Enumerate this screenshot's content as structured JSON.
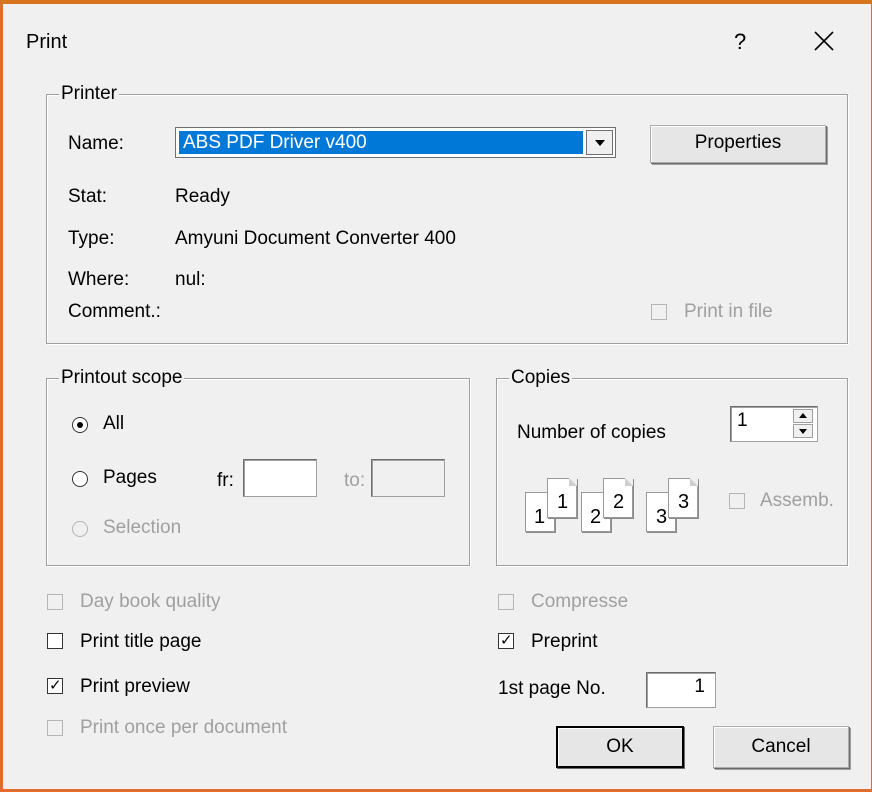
{
  "dialog": {
    "title": "Print",
    "help_label": "?"
  },
  "printer": {
    "legend": "Printer",
    "name_label": "Name:",
    "name_value": "ABS PDF Driver v400",
    "properties_label": "Properties",
    "stat_label": "Stat:",
    "stat_value": "Ready",
    "type_label": "Type:",
    "type_value": "Amyuni Document Converter 400",
    "where_label": "Where:",
    "where_value": "nul:",
    "comment_label": "Comment.:",
    "print_in_file_label": "Print in file",
    "print_in_file_checked": false
  },
  "scope": {
    "legend": "Printout scope",
    "all_label": "All",
    "pages_label": "Pages",
    "from_label": "fr:",
    "from_value": "",
    "to_label": "to:",
    "to_value": "",
    "selection_label": "Selection",
    "selected": "All"
  },
  "copies": {
    "legend": "Copies",
    "number_label": "Number of copies",
    "number_value": "1",
    "pages": [
      "1",
      "1",
      "2",
      "2",
      "3",
      "3"
    ],
    "assemble_label": "Assemb.",
    "assemble_checked": false
  },
  "options": {
    "day_book_quality_label": "Day book quality",
    "print_title_page_label": "Print title page",
    "print_preview_label": "Print preview",
    "print_once_label": "Print once per document",
    "compressed_label": "Compresse",
    "preprint_label": "Preprint",
    "first_page_label": "1st page No.",
    "first_page_value": "1",
    "print_preview_checked": true,
    "preprint_checked": true
  },
  "buttons": {
    "ok_label": "OK",
    "cancel_label": "Cancel"
  }
}
